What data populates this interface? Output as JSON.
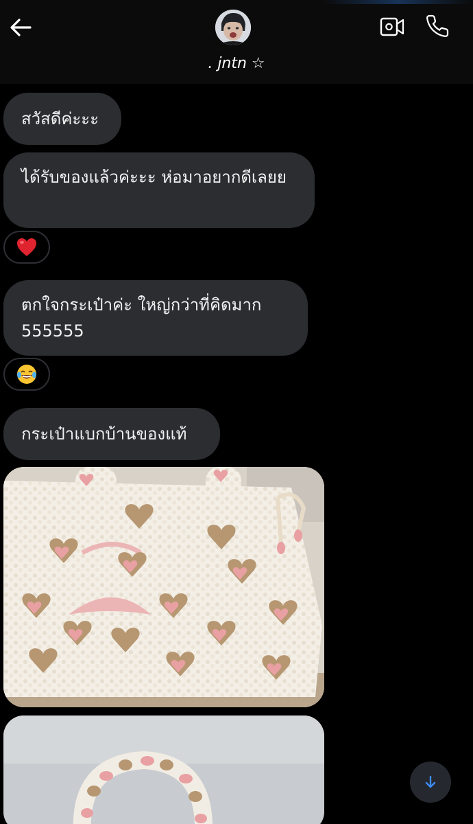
{
  "header": {
    "contact_name": ". jntn ☆",
    "back_icon": "arrow-left-icon",
    "video_icon": "video-camera-icon",
    "call_icon": "phone-icon"
  },
  "messages": [
    {
      "text": "สวัสดีค่ะะะ"
    },
    {
      "text": "ได้รับของแล้วค่ะะะ ห่อมาอยากดีเลยย",
      "reaction": "❤️"
    },
    {
      "text": "ตกใจกระเป๋าค่ะ ใหญ่กว่าที่คิดมาก 555555",
      "reaction": "😂"
    },
    {
      "text": "กระเป๋าแบกบ้านของแท้"
    }
  ],
  "attachments": [
    {
      "type": "photo",
      "subject": "white fleece tote bag with pink and brown hearts"
    },
    {
      "type": "photo",
      "subject": "fleece bag handle"
    }
  ],
  "colors": {
    "background": "#000000",
    "header": "#0b0b0b",
    "bubble": "#2b2d31",
    "accent": "#3d8bfd",
    "bag_pink": "#e9a0a3",
    "bag_brown": "#b69771"
  },
  "scroll_button": {
    "icon": "arrow-down-icon"
  }
}
